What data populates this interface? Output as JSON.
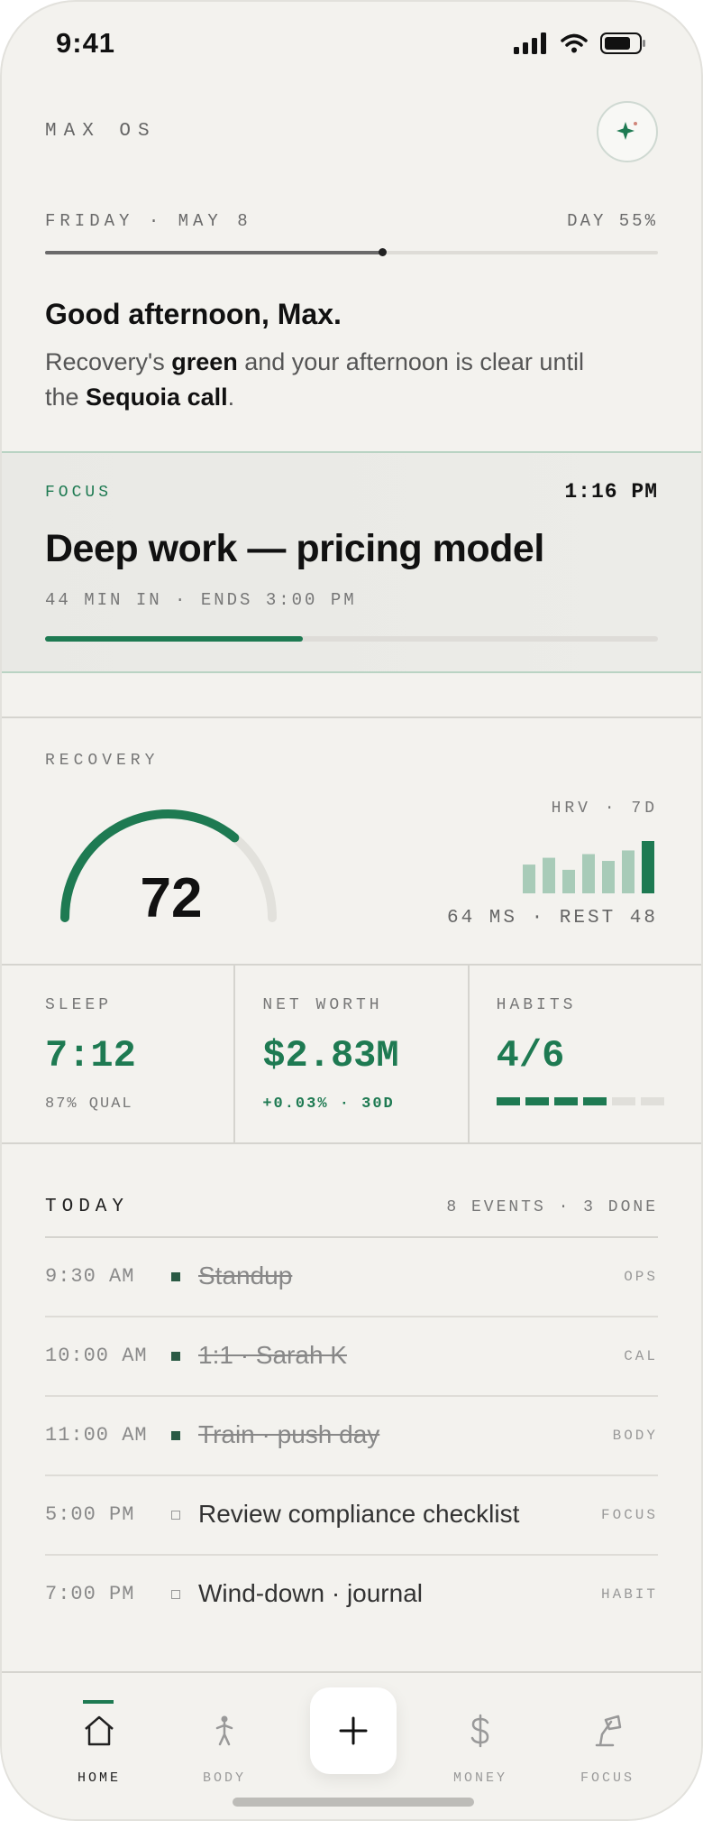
{
  "status_bar": {
    "time": "9:41"
  },
  "header": {
    "app_title": "MAX OS",
    "assistant_icon": "sparkle-icon"
  },
  "day": {
    "date": "FRIDAY · MAY 8",
    "progress_label": "DAY 55%",
    "progress": 0.55
  },
  "greeting": {
    "title": "Good afternoon, Max.",
    "line_a": "Recovery's ",
    "bold_a": "green",
    "line_b": " and your afternoon is clear until the ",
    "bold_b": "Sequoia call",
    "line_c": "."
  },
  "focus": {
    "label": "FOCUS",
    "clock": "1:16 PM",
    "title": "Deep work — pricing model",
    "meta": "44 MIN IN · ENDS 3:00 PM",
    "progress": 0.42
  },
  "recovery": {
    "label": "RECOVERY",
    "score": "72",
    "score_value": 72,
    "hrv_label": "HRV · 7D",
    "hrv_meta": "64 MS · REST 48",
    "hrv_bars": [
      0.55,
      0.68,
      0.45,
      0.75,
      0.62,
      0.82,
      1.0
    ]
  },
  "stats": {
    "sleep": {
      "label": "SLEEP",
      "value": "7:12",
      "sub": "87% QUAL"
    },
    "net_worth": {
      "label": "NET WORTH",
      "value": "$2.83M",
      "sub": "+0.03% · 30D"
    },
    "habits": {
      "label": "HABITS",
      "value": "4/6",
      "done": 4,
      "total": 6
    }
  },
  "today": {
    "label": "TODAY",
    "meta": "8 EVENTS · 3 DONE",
    "events": [
      {
        "time": "9:30 AM",
        "title": "Standup",
        "tag": "OPS",
        "done": true
      },
      {
        "time": "10:00 AM",
        "title": "1:1 · Sarah K",
        "tag": "CAL",
        "done": true
      },
      {
        "time": "11:00 AM",
        "title": "Train · push day",
        "tag": "BODY",
        "done": true
      },
      {
        "time": "5:00 PM",
        "title": "Review compliance checklist",
        "tag": "FOCUS",
        "done": false
      },
      {
        "time": "7:00 PM",
        "title": "Wind-down · journal",
        "tag": "HABIT",
        "done": false
      }
    ]
  },
  "tabs": [
    {
      "label": "HOME",
      "icon": "home-icon",
      "active": true
    },
    {
      "label": "BODY",
      "icon": "person-icon",
      "active": false
    },
    {
      "label": "MONEY",
      "icon": "dollar-icon",
      "active": false
    },
    {
      "label": "FOCUS",
      "icon": "lamp-icon",
      "active": false
    }
  ],
  "colors": {
    "accent": "#1e7a52",
    "background": "#f3f2ee",
    "muted": "#777777"
  }
}
